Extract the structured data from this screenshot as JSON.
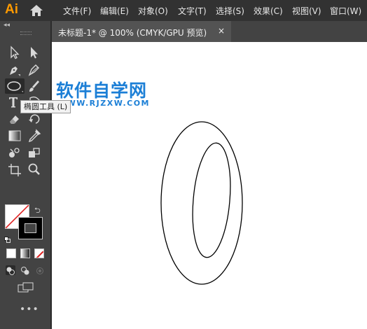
{
  "app": {
    "logo": "Ai"
  },
  "menu": {
    "items": [
      "文件(F)",
      "编辑(E)",
      "对象(O)",
      "文字(T)",
      "选择(S)",
      "效果(C)",
      "视图(V)",
      "窗口(W)"
    ]
  },
  "document_tab": {
    "title": "未标题-1* @ 100% (CMYK/GPU 预览)",
    "close": "×"
  },
  "toolbar": {
    "collapse_glyph": "◂◂",
    "tooltip": "椭圆工具 (L)",
    "more": "•••"
  },
  "watermark": {
    "text": "软件自学网",
    "url": "WWW.RJZXW.COM"
  },
  "colors": {
    "accent": "#ff9a00",
    "watermark": "#1c7fd6",
    "canvas": "#ffffff"
  }
}
